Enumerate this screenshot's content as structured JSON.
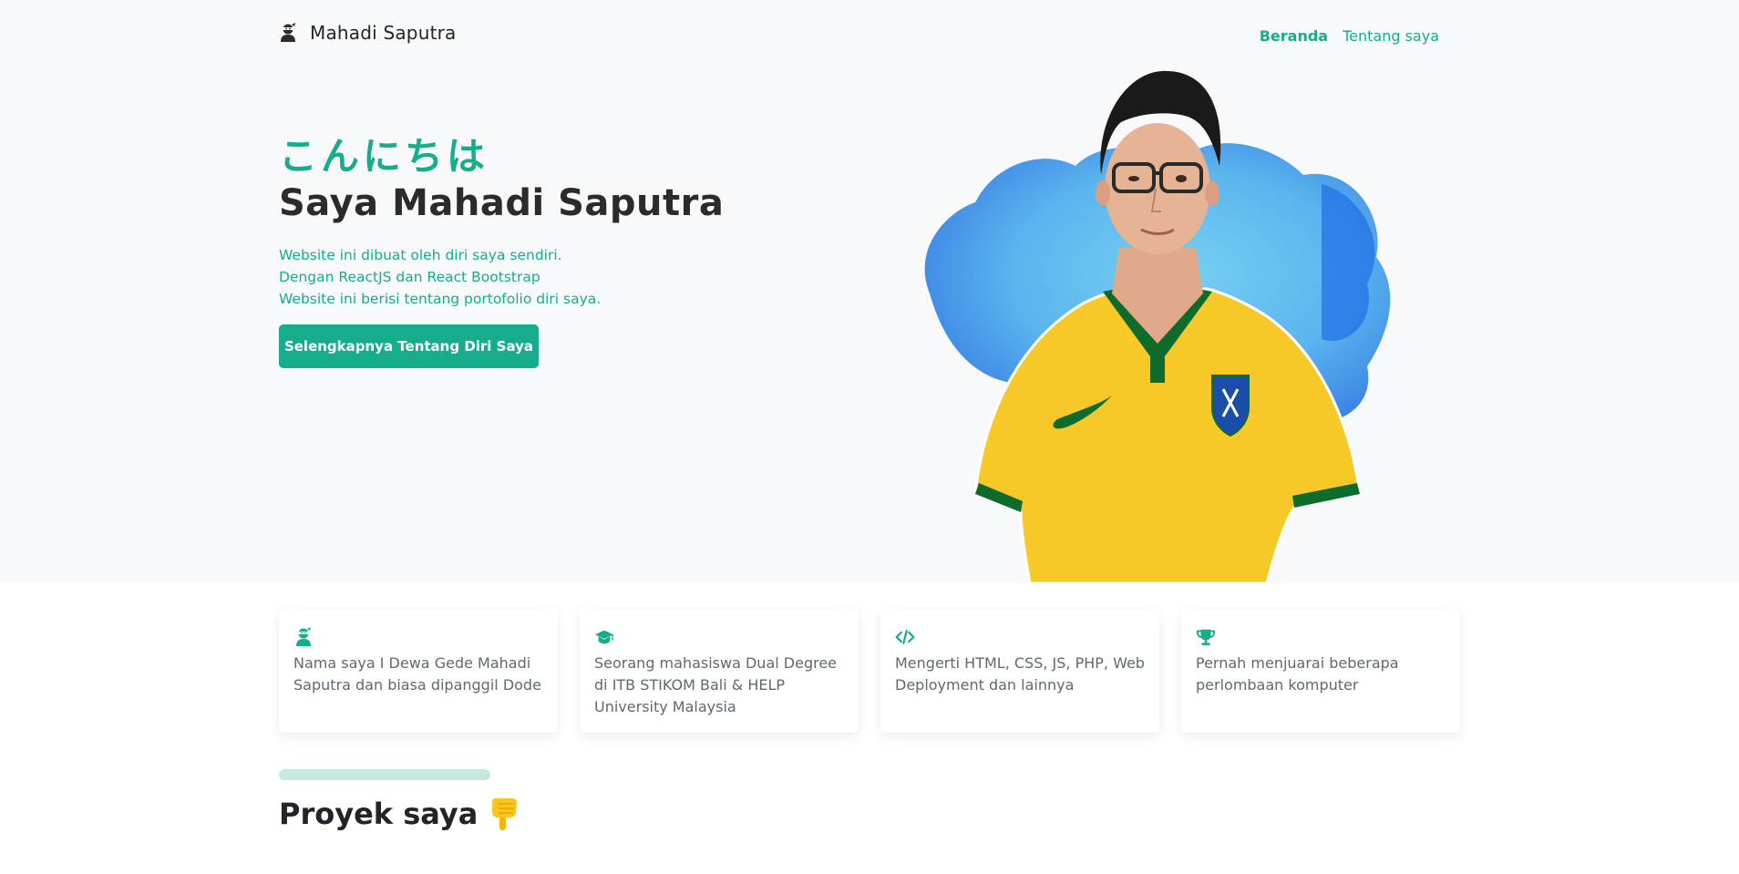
{
  "navbar": {
    "brand": "Mahadi Saputra",
    "brand_icon": "user-ninja-icon",
    "links": [
      {
        "label": "Beranda",
        "active": true
      },
      {
        "label": "Tentang saya",
        "active": false
      }
    ]
  },
  "hero": {
    "greeting": "こんにちは",
    "headline": "Saya Mahadi Saputra",
    "lead_lines": [
      "Website ini dibuat oleh diri saya sendiri.",
      "Dengan ReactJS dan React Bootstrap",
      "Website ini berisi tentang portofolio diri saya."
    ],
    "cta_label": "Selengkapnya Tentang Diri Saya",
    "photo_icon": "portrait-photo"
  },
  "cards": [
    {
      "icon": "user-ninja-icon",
      "text": "Nama saya I Dewa Gede Mahadi Saputra dan biasa dipanggil Dode"
    },
    {
      "icon": "graduation-cap-icon",
      "text": "Seorang mahasiswa Dual Degree di ITB STIKOM Bali & HELP University Malaysia"
    },
    {
      "icon": "code-icon",
      "text": "Mengerti HTML, CSS, JS, PHP, Web Deployment dan lainnya"
    },
    {
      "icon": "trophy-icon",
      "text": "Pernah menjuarai beberapa perlombaan komputer"
    }
  ],
  "projects": {
    "title": "Proyek saya",
    "emoji_icon": "pointing-down-hand-icon"
  },
  "colors": {
    "accent": "#15ad8c",
    "hero_bg": "#f8f9fa",
    "divider": "#c4e9e1",
    "jersey_yellow": "#f6c928",
    "jersey_green": "#0d6b2c"
  }
}
